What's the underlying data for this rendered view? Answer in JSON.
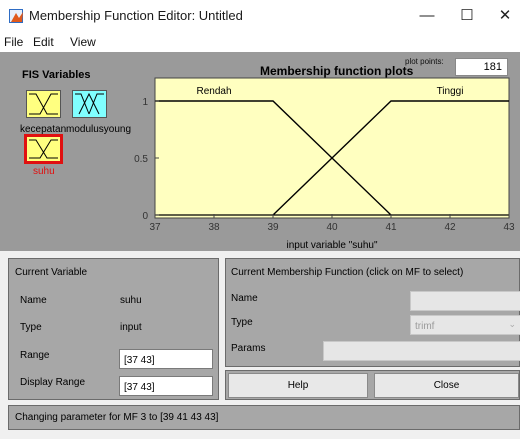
{
  "window": {
    "title": "Membership Function Editor: Untitled",
    "minimize": "—",
    "maximize": "☐",
    "close": "✕"
  },
  "menu": [
    "File",
    "Edit",
    "View"
  ],
  "fis_variables": {
    "title": "FIS Variables",
    "items": [
      {
        "label": "kecepatan",
        "color": "#ffff80",
        "selected": false
      },
      {
        "label": "modulusyoung",
        "color": "#80ffff",
        "selected": false
      },
      {
        "label": "suhu",
        "color": "#ffff80",
        "selected": true
      }
    ]
  },
  "plot": {
    "title": "Membership function plots",
    "plot_points_label": "plot points:",
    "plot_points": "181",
    "xlabel": "input variable \"suhu\"",
    "background": "#ffffc0"
  },
  "chart_data": {
    "type": "line",
    "title": "Membership function plots",
    "xlabel": "input variable \"suhu\"",
    "xlim": [
      37,
      43
    ],
    "ylim": [
      0,
      1
    ],
    "x_ticks": [
      "37",
      "38",
      "39",
      "40",
      "41",
      "42",
      "43"
    ],
    "y_ticks": [
      "0",
      "0.5",
      "1"
    ],
    "series": [
      {
        "name": "Rendah",
        "x": [
          37,
          39,
          41
        ],
        "y": [
          1,
          1,
          0
        ]
      },
      {
        "name": "Tinggi",
        "x": [
          39,
          41,
          43
        ],
        "y": [
          0,
          1,
          1
        ]
      }
    ],
    "baseline": {
      "x": [
        37,
        43
      ],
      "y": [
        0,
        0
      ]
    }
  },
  "current_variable": {
    "title": "Current Variable",
    "name_label": "Name",
    "name_value": "suhu",
    "type_label": "Type",
    "type_value": "input",
    "range_label": "Range",
    "range_value": "[37 43]",
    "display_range_label": "Display Range",
    "display_range_value": "[37 43]"
  },
  "current_mf": {
    "title": "Current Membership Function (click on MF to select)",
    "name_label": "Name",
    "name_value": "",
    "type_label": "Type",
    "type_value": "trimf",
    "params_label": "Params",
    "params_value": ""
  },
  "buttons": {
    "help": "Help",
    "close": "Close"
  },
  "status": "Changing parameter for MF 3 to  [39 41 43 43]"
}
